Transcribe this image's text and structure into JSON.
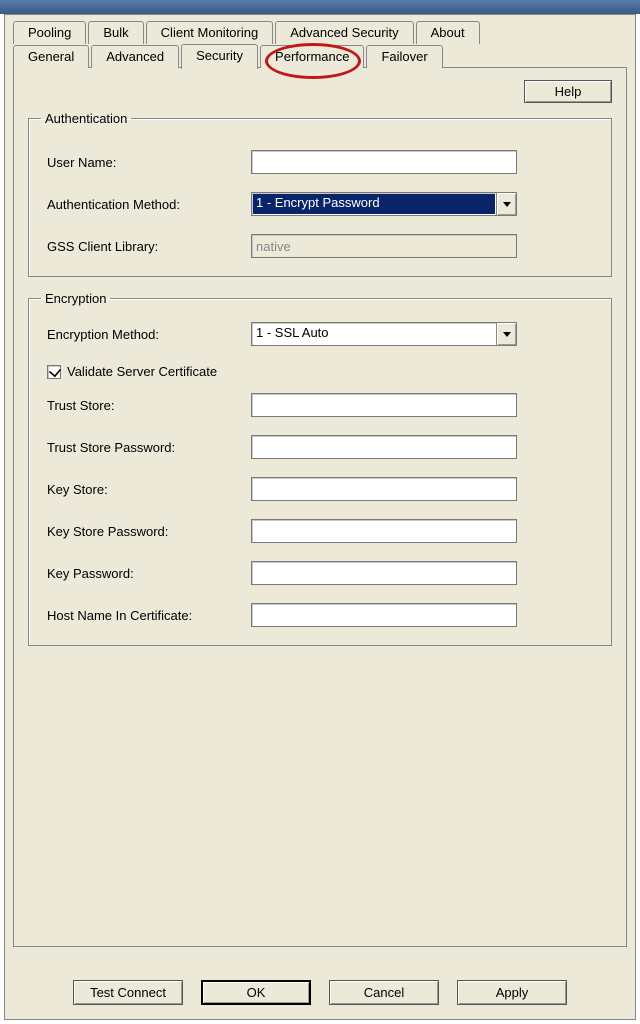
{
  "tabs_back": [
    "Pooling",
    "Bulk",
    "Client Monitoring",
    "Advanced Security",
    "About"
  ],
  "tabs_front": [
    "General",
    "Advanced",
    "Security",
    "Performance",
    "Failover"
  ],
  "active_tab": "Security",
  "help_button": "Help",
  "groups": {
    "authentication": {
      "legend": "Authentication",
      "user_name_label": "User Name:",
      "user_name_value": "",
      "auth_method_label": "Authentication Method:",
      "auth_method_value": "1 - Encrypt Password",
      "gss_library_label": "GSS Client Library:",
      "gss_library_value": "native"
    },
    "encryption": {
      "legend": "Encryption",
      "enc_method_label": "Encryption Method:",
      "enc_method_value": "1 - SSL Auto",
      "validate_cert_label": "Validate Server Certificate",
      "validate_cert_checked": true,
      "trust_store_label": "Trust Store:",
      "trust_store_value": "",
      "trust_store_pw_label": "Trust Store Password:",
      "trust_store_pw_value": "",
      "key_store_label": "Key Store:",
      "key_store_value": "",
      "key_store_pw_label": "Key Store Password:",
      "key_store_pw_value": "",
      "key_pw_label": "Key Password:",
      "key_pw_value": "",
      "host_cert_label": "Host Name In Certificate:",
      "host_cert_value": ""
    }
  },
  "bottom_buttons": {
    "test_connect": "Test Connect",
    "ok": "OK",
    "cancel": "Cancel",
    "apply": "Apply"
  }
}
